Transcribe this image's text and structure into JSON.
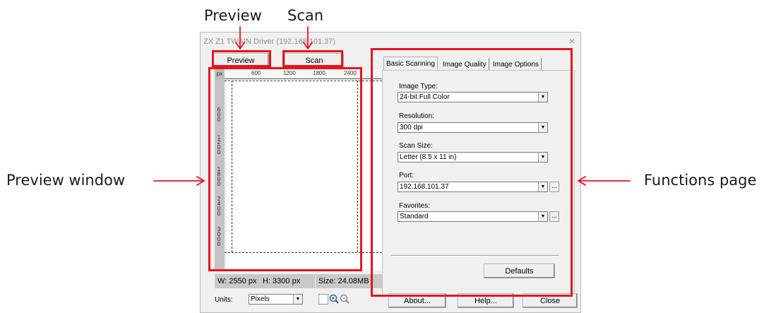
{
  "annotations": {
    "preview": "Preview",
    "scan": "Scan",
    "preview_window": "Preview window",
    "functions_page": "Functions page"
  },
  "window": {
    "title": "ZX Z1 TWAIN Driver (192.168.101.37)",
    "close_glyph": "×"
  },
  "buttons": {
    "preview": "Preview",
    "scan": "Scan",
    "defaults": "Defaults",
    "about": "About...",
    "help": "Help...",
    "close": "Close"
  },
  "ruler": {
    "unit": "px",
    "top_ticks": [
      "600",
      "1200",
      "1800",
      "2400"
    ],
    "left_ticks": [
      "6\n0\n0",
      "1\n2\n0\n0",
      "1\n8\n0\n0",
      "2\n4\n0\n0",
      "3\n0\n0\n0"
    ]
  },
  "status": {
    "width": "W: 2550 px",
    "height": "H: 3300 px",
    "size": "Size: 24.08MB"
  },
  "units": {
    "label": "Units:",
    "value": "Pixels"
  },
  "tabs": [
    "Basic Scanning",
    "Image Quality",
    "Image Options"
  ],
  "fields": {
    "image_type": {
      "label": "Image Type:",
      "value": "24-bit Full Color"
    },
    "resolution": {
      "label": "Resolution:",
      "value": "300 dpi"
    },
    "scan_size": {
      "label": "Scan Size:",
      "value": "Letter (8.5 x 11 in)"
    },
    "port": {
      "label": "Port:",
      "value": "192.168.101.37"
    },
    "favorites": {
      "label": "Favorites:",
      "value": "Standard"
    }
  },
  "icons": {
    "dropdown": "▼",
    "ellipsis": "...",
    "zoom_in": "zoom-in-icon",
    "zoom_out": "zoom-out-icon",
    "select": "selection-rectangle-icon"
  },
  "colors": {
    "annotation_red": "#e8141b",
    "ruler_gray": "#c3c3c3",
    "status_gray": "#c9c9c9",
    "dialog_bg": "#f0f0f0"
  }
}
